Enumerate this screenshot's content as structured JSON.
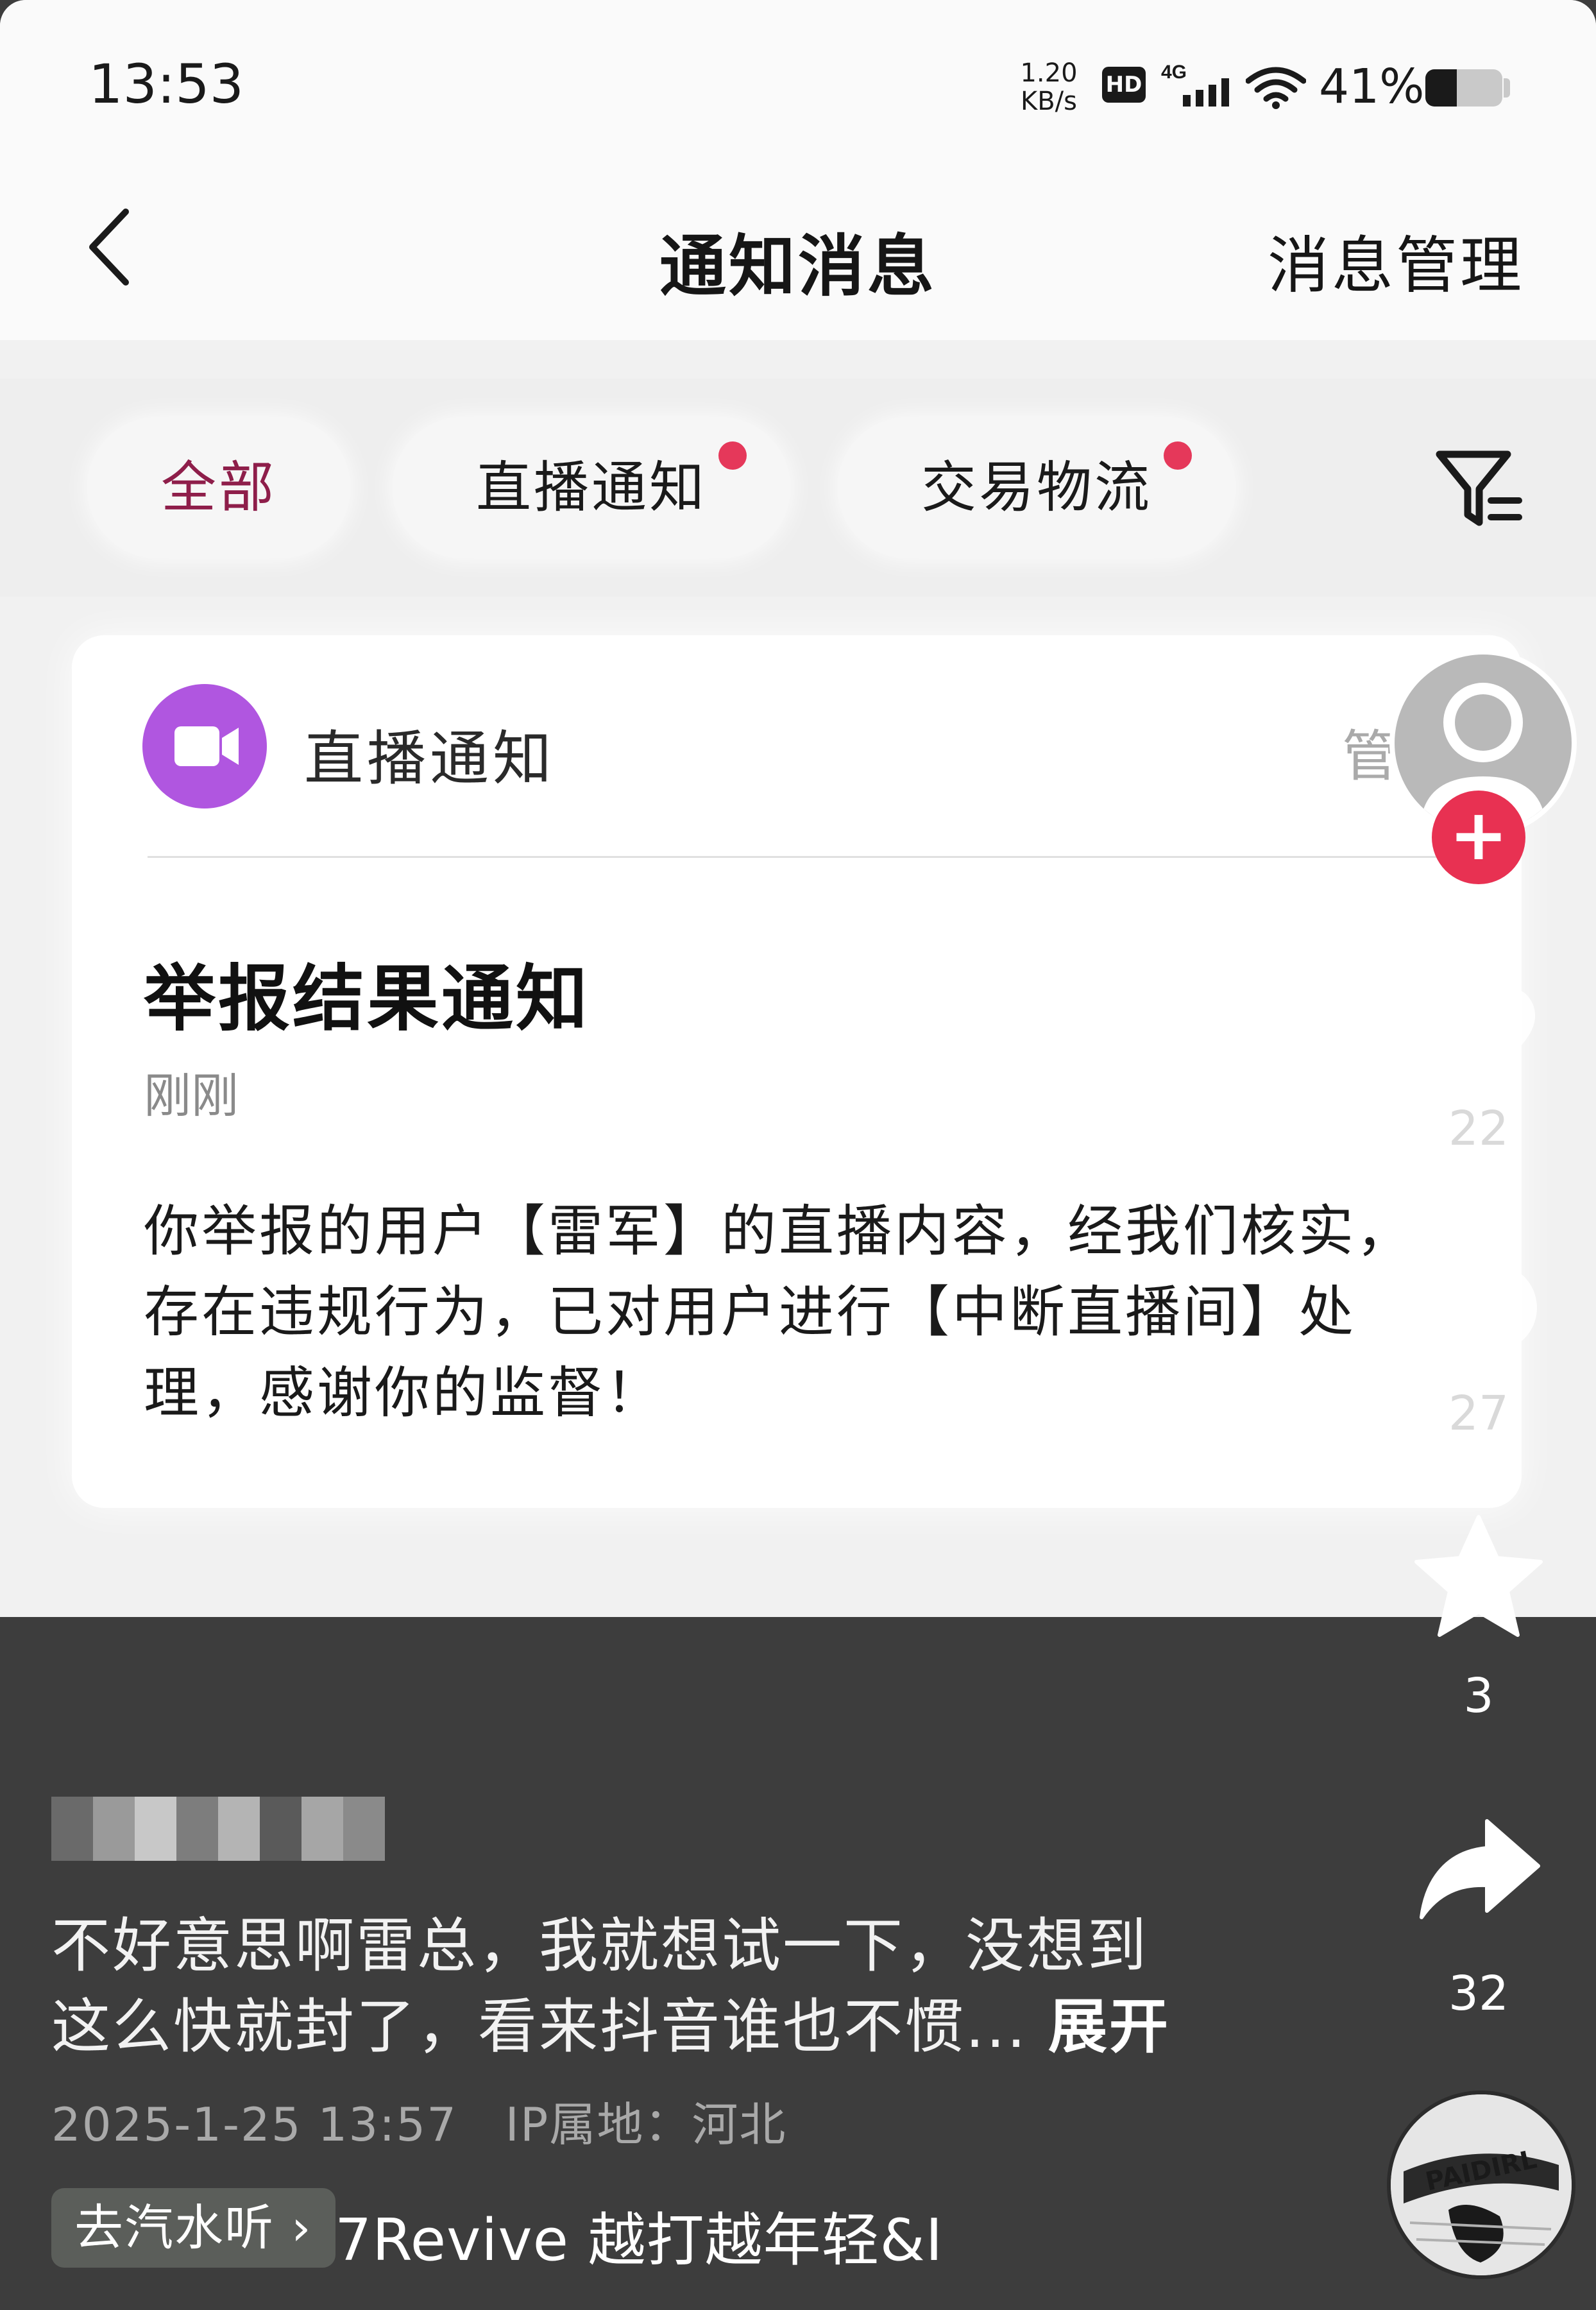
{
  "status_bar": {
    "time": "13:53",
    "net_speed_value": "1.20",
    "net_speed_unit": "KB/s",
    "hd_badge": "HD",
    "network_type": "4G",
    "battery_text": "41%",
    "battery_level": 0.41,
    "icons": [
      "signal-icon",
      "wifi-icon",
      "battery-icon"
    ]
  },
  "header": {
    "title": "通知消息",
    "right_action": "消息管理",
    "back_icon": "chevron-left-icon"
  },
  "tabs": [
    {
      "label": "全部",
      "active": true,
      "has_dot": false
    },
    {
      "label": "直播通知",
      "active": false,
      "has_dot": true
    },
    {
      "label": "交易物流",
      "active": false,
      "has_dot": true
    }
  ],
  "filter_icon": "filter-icon",
  "notification": {
    "channel": "直播通知",
    "channel_icon": "video-camera-icon",
    "more_text": "管",
    "title": "举报结果通知",
    "time": "刚刚",
    "body": "你举报的用户【雷军】的直播内容，经我们核实，存在违规行为，已对用户进行【中断直播间】处理，感谢你的监督！"
  },
  "post": {
    "caption_lines": [
      "不好意思啊雷总，我就想试一下，没想到",
      "这么快就封了，看来抖音谁也不惯..."
    ],
    "expand_label": "展开",
    "date": "2025-1-25 13:57",
    "ip_label": "IP属地：河北",
    "music_chip": "去汽水听 ›",
    "music_track": "7Revive   越打越年轻&I"
  },
  "actions": {
    "follow_label": "+",
    "like_count": "22",
    "comment_count": "27",
    "favorite_count": "3",
    "share_count": "32",
    "disc_text": "PAIDIRL"
  },
  "colors": {
    "accent_active_tab": "#8e1e4a",
    "badge_dot": "#e5385a",
    "follow_button": "#e83152",
    "channel_avatar": "#b056e0",
    "overlay_background": "#3d3d3d"
  }
}
